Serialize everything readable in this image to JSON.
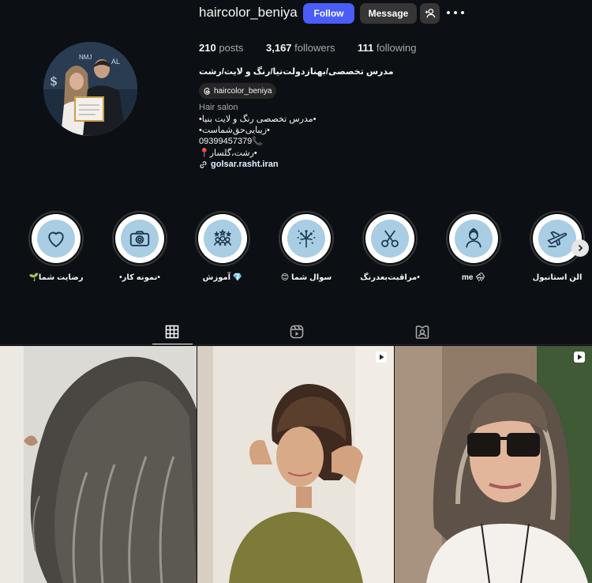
{
  "profile": {
    "username": "haircolor_beniya",
    "follow_label": "Follow",
    "message_label": "Message",
    "stats": {
      "posts_count": "210",
      "posts_label": "posts",
      "followers_count": "3,167",
      "followers_label": "followers",
      "following_count": "111",
      "following_label": "following"
    },
    "full_name": "مدرس تخصصی/بهنازدولت‌نیا/رنگ و لایت/رشت",
    "threads_handle": "haircolor_beniya",
    "category": "Hair salon",
    "bio_lines": [
      "•مدرس تخصصی رنگ و لایت بنیا•",
      "•زیبایی‌حق‌شماست•",
      "09399457379📞",
      "•رشت،گلسار📍"
    ],
    "link": "golsar.rasht.iran"
  },
  "highlights": [
    {
      "label": "رضایت شما🌱",
      "icon": "heart-icon"
    },
    {
      "label": "•نمونه کار•",
      "icon": "camera-icon"
    },
    {
      "label": "💎 آموزش",
      "icon": "group-stars-icon"
    },
    {
      "label": "سوال شما 😊",
      "icon": "fireworks-icon"
    },
    {
      "label": "•مراقبت‌بعدرنگ",
      "icon": "scissors-icon"
    },
    {
      "label": "me 🌧",
      "icon": "woman-icon"
    },
    {
      "label": "الن استانبول",
      "icon": "airplane-icon"
    }
  ],
  "tabs": [
    "grid-icon",
    "reels-icon",
    "tagged-icon"
  ],
  "posts": [
    {
      "type": "image",
      "icon": ""
    },
    {
      "type": "reel",
      "icon": "reel-icon"
    },
    {
      "type": "reel",
      "icon": "reel-icon"
    }
  ],
  "colors": {
    "background": "#0c1014",
    "follow_button": "#4a5df9",
    "secondary_button": "#363636",
    "highlight_disc": "#a9cde3"
  }
}
